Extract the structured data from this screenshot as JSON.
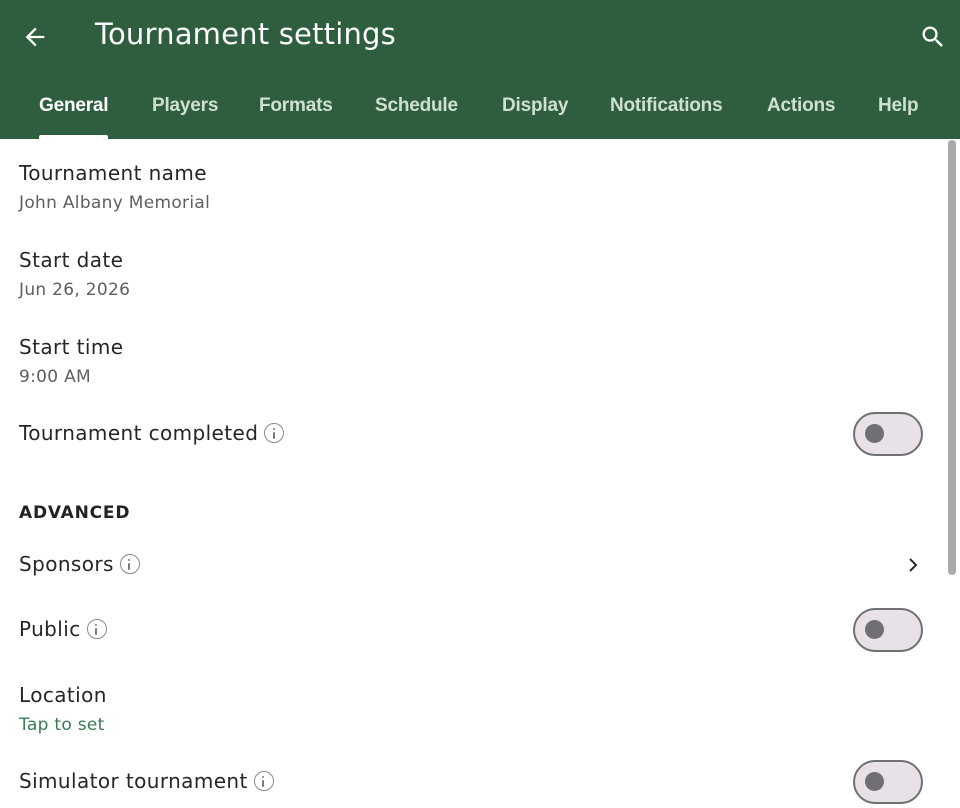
{
  "header": {
    "title": "Tournament settings",
    "back_icon": "arrow-left-icon",
    "search_icon": "search-icon",
    "background": "#2e5e3d"
  },
  "tabs": [
    {
      "label": "General",
      "active": true
    },
    {
      "label": "Players",
      "active": false
    },
    {
      "label": "Formats",
      "active": false
    },
    {
      "label": "Schedule",
      "active": false
    },
    {
      "label": "Display",
      "active": false
    },
    {
      "label": "Notifications",
      "active": false
    },
    {
      "label": "Actions",
      "active": false
    },
    {
      "label": "Help",
      "active": false
    }
  ],
  "general": {
    "tournament_name": {
      "label": "Tournament name",
      "value": "John Albany Memorial"
    },
    "start_date": {
      "label": "Start date",
      "value": "Jun 26, 2026"
    },
    "start_time": {
      "label": "Start time",
      "value": "9:00 AM"
    },
    "tournament_completed": {
      "label": "Tournament completed",
      "enabled": false
    }
  },
  "advanced": {
    "heading": "ADVANCED",
    "sponsors": {
      "label": "Sponsors"
    },
    "public": {
      "label": "Public",
      "enabled": false
    },
    "location": {
      "label": "Location",
      "value": "Tap to set"
    },
    "simulator_tournament": {
      "label": "Simulator tournament",
      "enabled": false
    }
  },
  "colors": {
    "accent": "#2e5e3d",
    "link": "#3a7a52",
    "toggle_off_track": "#e8e2e8",
    "toggle_off_outline": "#6f6f74"
  }
}
